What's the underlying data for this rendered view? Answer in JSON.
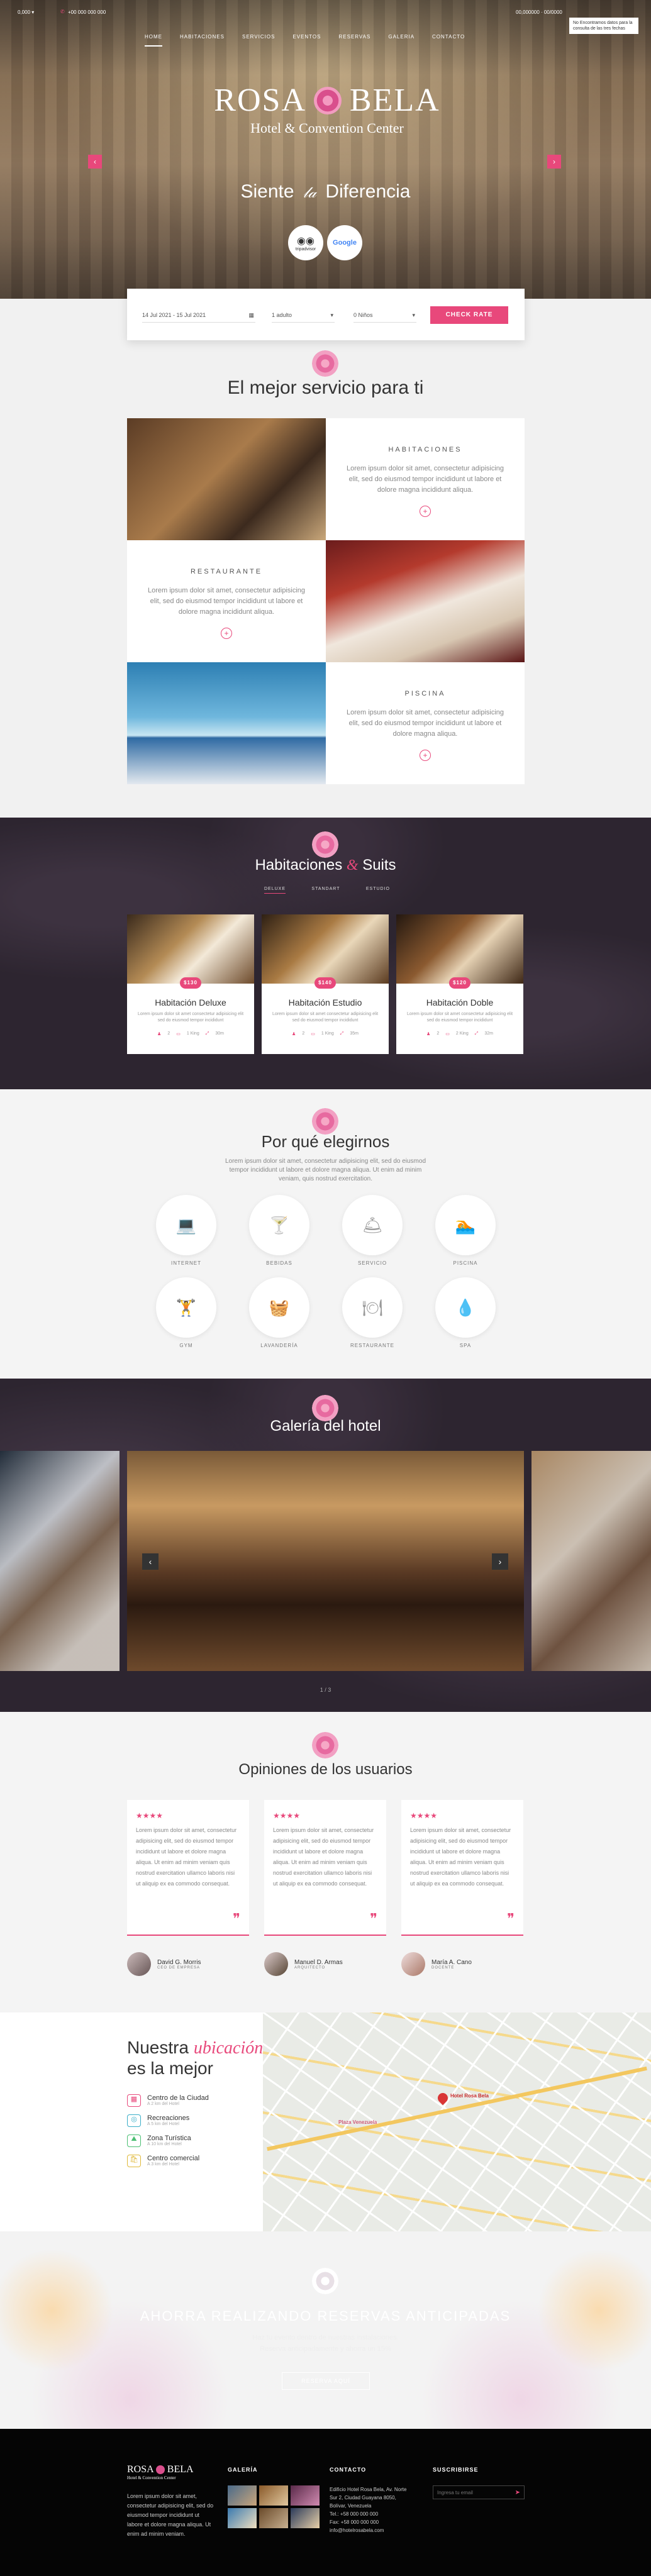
{
  "topbar": {
    "left": "0,000 ▾",
    "phone": "+00 000 000 000",
    "right": "00,000000 · 00/0000",
    "notice": "No Encontramos datos para la consulta de las tres fechas"
  },
  "nav": {
    "items": [
      "HOME",
      "HABITACIONES",
      "SERVICIOS",
      "EVENTOS",
      "RESERVAS",
      "GALERIA",
      "CONTACTO"
    ]
  },
  "hero": {
    "brand_left": "ROSA",
    "brand_right": "BELA",
    "brand_sub": "Hotel & Convention Center",
    "tagline_left": "Siente",
    "tagline_right": "Diferencia",
    "badge1": "tripadvisor",
    "badge2": "Google"
  },
  "booking": {
    "dates": "14 Jul 2021 - 15 Jul 2021",
    "adults": "1 adulto",
    "children": "0 Niños",
    "submit": "CHECK RATE"
  },
  "services": {
    "title": "El mejor servicio para ti",
    "items": [
      {
        "name": "HABITACIONES",
        "text": "Lorem ipsum dolor sit amet, consectetur adipisicing elit, sed do eiusmod tempor incididunt ut labore et dolore magna incididunt aliqua."
      },
      {
        "name": "RESTAURANTE",
        "text": "Lorem ipsum dolor sit amet, consectetur adipisicing elit, sed do eiusmod tempor incididunt ut labore et dolore magna incididunt aliqua."
      },
      {
        "name": "PISCINA",
        "text": "Lorem ipsum dolor sit amet, consectetur adipisicing elit, sed do eiusmod tempor incididunt ut labore et dolore magna aliqua."
      }
    ]
  },
  "rooms": {
    "title_left": "Habitaciones",
    "title_right": "Suits",
    "tabs": [
      "DELUXE",
      "STANDART",
      "ESTUDIO"
    ],
    "cards": [
      {
        "name": "Habitación Deluxe",
        "price": "$130",
        "desc": "Lorem ipsum dolor sit amet consectetur adipisicing elit sed do eiusmod tempor incididunt",
        "f1": "2",
        "f2": "1 King",
        "f3": "30m"
      },
      {
        "name": "Habitación Estudio",
        "price": "$140",
        "desc": "Lorem ipsum dolor sit amet consectetur adipisicing elit sed do eiusmod tempor incididunt",
        "f1": "2",
        "f2": "1 King",
        "f3": "35m"
      },
      {
        "name": "Habitación Doble",
        "price": "$120",
        "desc": "Lorem ipsum dolor sit amet consectetur adipisicing elit sed do eiusmod tempor incididunt",
        "f1": "2",
        "f2": "2 King",
        "f3": "32m"
      }
    ]
  },
  "why": {
    "title": "Por qué elegirnos",
    "text": "Lorem ipsum dolor sit amet, consectetur adipisicing elit, sed do eiusmod tempor incididunt ut labore et dolore magna aliqua. Ut enim ad minim veniam, quis nostrud exercitation.",
    "items": [
      {
        "label": "INTERNET",
        "glyph": "⌨"
      },
      {
        "label": "BEBIDAS",
        "glyph": "🍸"
      },
      {
        "label": "SERVICIO",
        "glyph": "🛎"
      },
      {
        "label": "PISCINA",
        "glyph": "🏊"
      },
      {
        "label": "GYM",
        "glyph": "🏋"
      },
      {
        "label": "LAVANDERÍA",
        "glyph": "🧺"
      },
      {
        "label": "RESTAURANTE",
        "glyph": "🍽"
      },
      {
        "label": "SPA",
        "glyph": "💧"
      }
    ]
  },
  "gallery": {
    "title": "Galería del hotel",
    "counter": "1 / 3"
  },
  "reviews": {
    "title": "Opiniones de los usuarios",
    "stars": "★★★★",
    "text": "Lorem ipsum dolor sit amet, consectetur adipisicing elit, sed do eiusmod tempor incididunt ut labore et dolore magna aliqua. Ut enim ad minim veniam quis nostrud exercitation ullamco laboris nisi ut aliquip ex ea commodo consequat.",
    "people": [
      {
        "name": "David G. Morris",
        "role": "CEO DE EMPRESA"
      },
      {
        "name": "Manuel D. Armas",
        "role": "ARQUITECTO"
      },
      {
        "name": "María A. Cano",
        "role": "DOCENTE"
      }
    ]
  },
  "location": {
    "title1": "Nuestra",
    "title_em": "ubicación",
    "title2": "es la mejor",
    "items": [
      {
        "name": "Centro de la Ciudad",
        "dist": "A 2 km del Hotel"
      },
      {
        "name": "Recreaciones",
        "dist": "A 5 km del Hotel"
      },
      {
        "name": "Zona Turística",
        "dist": "A 10 km del Hotel"
      },
      {
        "name": "Centro comercial",
        "dist": "A 3 km del Hotel"
      }
    ],
    "map_label": "Hotel Rosa Bela",
    "map_place": "Plaza Venezuela"
  },
  "promo": {
    "title": "AHORRA REALIZANDO RESERVAS ANTICIPADAS",
    "text": "Haz tu evento dentro de nuestras instalaciones. Reserva anticipadamente y ahorra un 15%",
    "button": "RESERVA AQUÍ"
  },
  "footer": {
    "about": "Lorem ipsum dolor sit amet, consectetur adipisicing elit, sed do eiusmod tempor incididunt ut labore et dolore magna aliqua. Ut enim ad minim veniam.",
    "gallery_title": "GALERÍA",
    "contact_title": "CONTACTO",
    "contact": [
      "Edificio Hotel Rosa Bela, Av. Norte",
      "Sur 2, Ciudad Guayana 8050,",
      "Bolívar, Venezuela",
      "Tel.: +58 000 000 000",
      "Fax: +58 000 000 000",
      "info@hotelrosabela.com"
    ],
    "subscribe_title": "SUSCRIBIRSE",
    "subscribe_placeholder": "Ingresa tu email"
  },
  "colors": {
    "accent": "#e8487b",
    "dark": "#2d2530"
  }
}
